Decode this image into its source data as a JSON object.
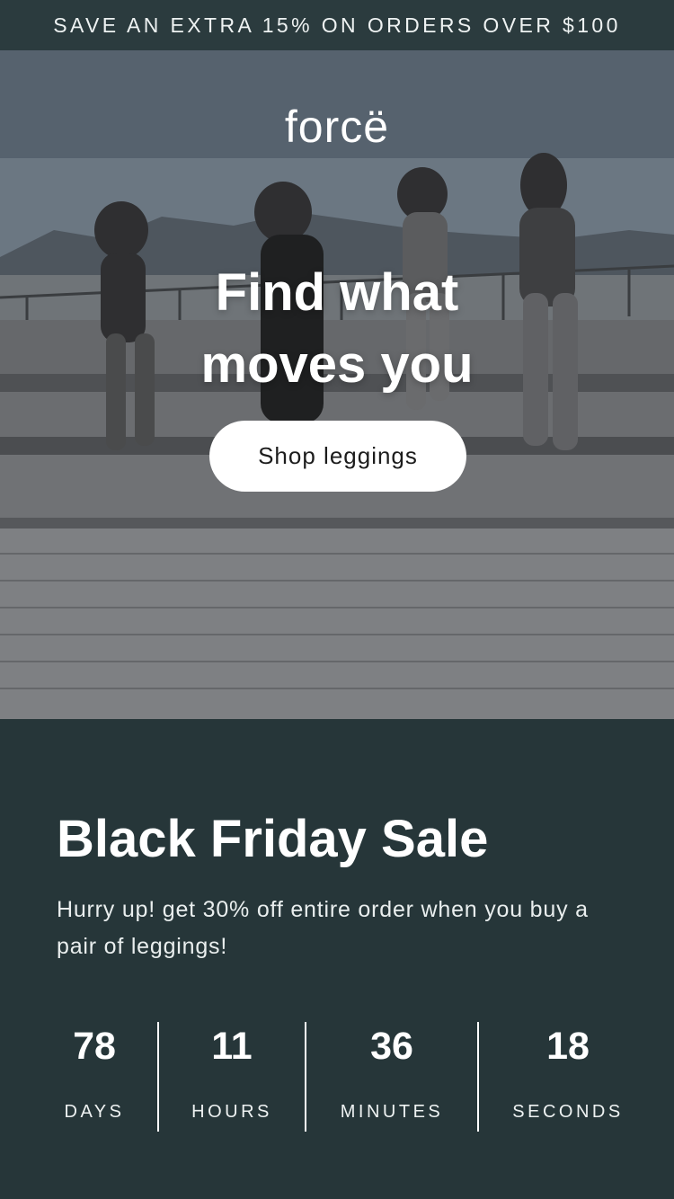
{
  "promo": {
    "text": "SAVE AN EXTRA 15% ON ORDERS OVER $100"
  },
  "hero": {
    "logo": "forcë",
    "headline_line1": "Find what",
    "headline_line2": "moves you",
    "cta_label": "Shop leggings"
  },
  "sale": {
    "title": "Black Friday Sale",
    "description": "Hurry up! get 30% off entire order when you buy a pair of leggings!",
    "countdown": [
      {
        "value": "78",
        "label": "DAYS"
      },
      {
        "value": "11",
        "label": "HOURS"
      },
      {
        "value": "36",
        "label": "MINUTES"
      },
      {
        "value": "18",
        "label": "SECONDS"
      }
    ]
  },
  "colors": {
    "promo_bar": "#2b3b3e",
    "sale_bg": "#263639",
    "cta_bg": "#ffffff",
    "text": "#ffffff"
  }
}
